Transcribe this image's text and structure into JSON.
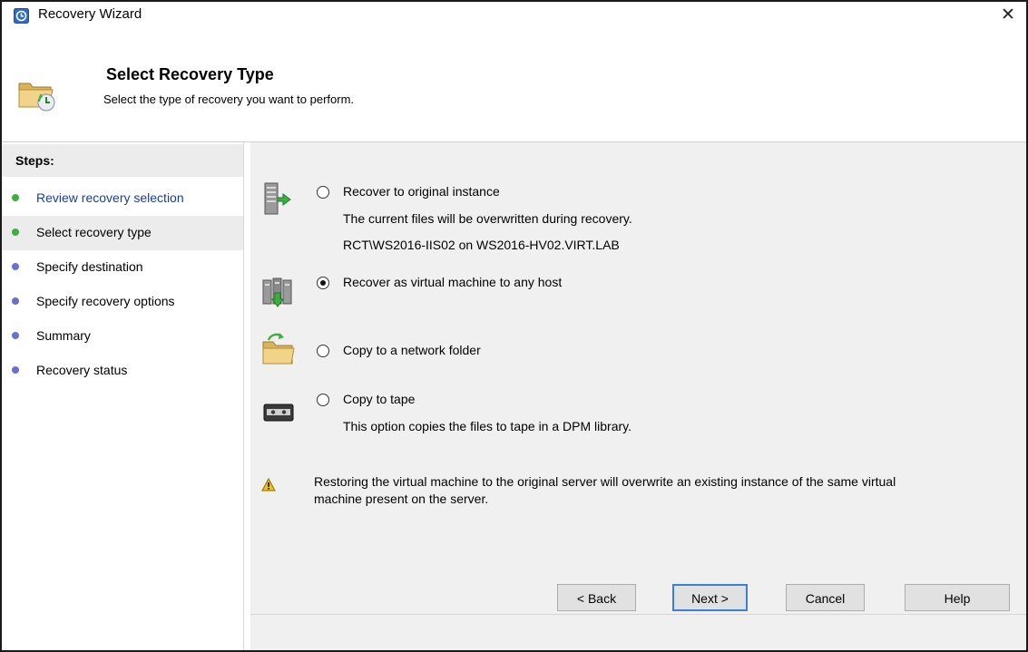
{
  "window": {
    "title": "Recovery Wizard",
    "close_glyph": "✕"
  },
  "header": {
    "title": "Select Recovery Type",
    "subtitle": "Select the type of recovery you want to perform."
  },
  "steps": {
    "heading": "Steps:",
    "items": [
      {
        "label": "Review recovery selection",
        "state": "completed",
        "dot_color": "#3fae3f"
      },
      {
        "label": "Select recovery type",
        "state": "current",
        "dot_color": "#3fae3f"
      },
      {
        "label": "Specify destination",
        "state": "pending",
        "dot_color": "#6a6fd2"
      },
      {
        "label": "Specify recovery options",
        "state": "pending",
        "dot_color": "#6a6fd2"
      },
      {
        "label": "Summary",
        "state": "pending",
        "dot_color": "#6a6fd2"
      },
      {
        "label": "Recovery status",
        "state": "pending",
        "dot_color": "#6a6fd2"
      }
    ]
  },
  "options": [
    {
      "label": "Recover to original instance",
      "checked": false,
      "icon": "server-restore-icon",
      "desc1": "The current files will be overwritten during recovery.",
      "desc2": "RCT\\WS2016-IIS02 on WS2016-HV02.VIRT.LAB"
    },
    {
      "label": "Recover as virtual machine to any host",
      "checked": true,
      "icon": "server-cluster-icon"
    },
    {
      "label": "Copy to a network folder",
      "checked": false,
      "icon": "network-folder-icon"
    },
    {
      "label": "Copy to tape",
      "checked": false,
      "icon": "tape-icon",
      "desc1": "This option copies the files to tape in a DPM library."
    }
  ],
  "warning": {
    "icon": "warning-icon",
    "line1": "Restoring the virtual machine to the original server will overwrite an existing instance of the same virtual",
    "line2": "machine present on the server."
  },
  "buttons": {
    "back": "< Back",
    "next": "Next >",
    "cancel": "Cancel",
    "help": "Help"
  },
  "colors": {
    "accent": "#3c7fd6",
    "link": "#1a3d9c",
    "completed": "#3fae3f",
    "pending": "#6a6fd2",
    "warning": "#f3c400"
  }
}
